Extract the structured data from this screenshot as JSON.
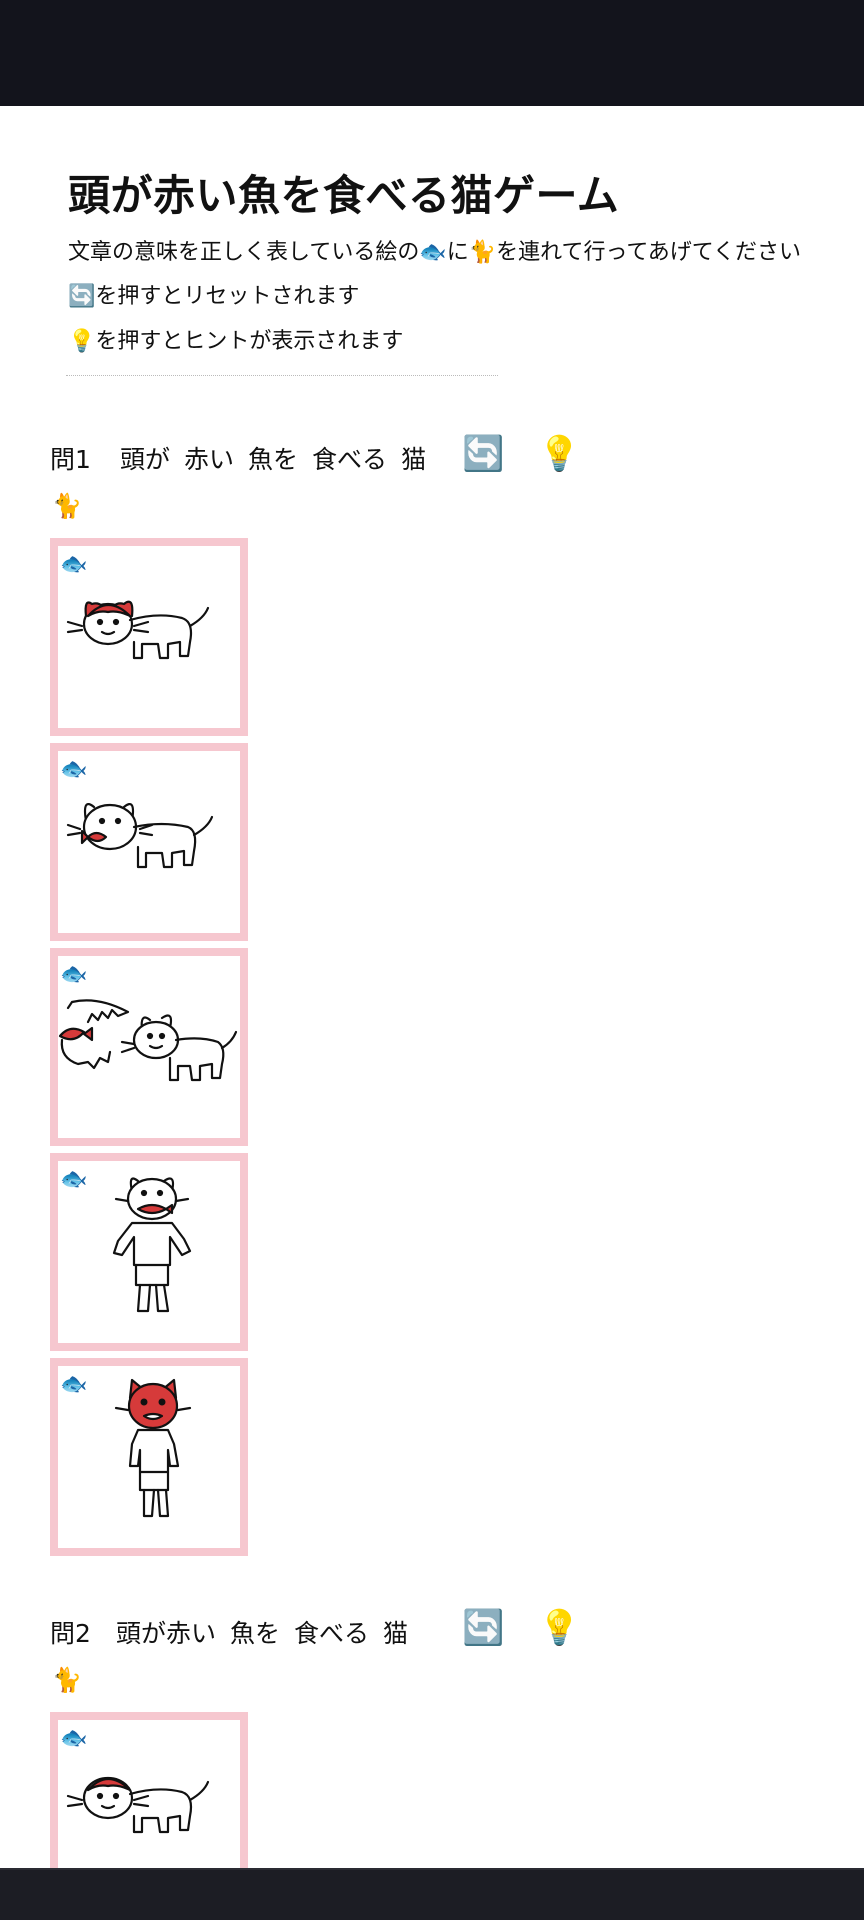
{
  "header": {
    "title": "頭が赤い魚を食べる猫ゲーム",
    "instructions": {
      "line1": "文章の意味を正しく表している絵の🐟に🐈を連れて行ってあげてください",
      "line2": "🔄を押すとリセットされます",
      "line3": "💡を押すとヒントが表示されます"
    }
  },
  "questions": [
    {
      "number": "問1",
      "words": [
        "頭が",
        "赤い",
        "魚を",
        "食べる",
        "猫"
      ],
      "reset_icon": "🔄",
      "hint_icon": "💡",
      "cat_icon": "🐈",
      "options": [
        {
          "fish_icon": "🐟",
          "picture": "cat-with-red-head-icon"
        },
        {
          "fish_icon": "🐟",
          "picture": "cat-eating-red-fish-icon"
        },
        {
          "fish_icon": "🐟",
          "picture": "shark-biting-red-fish-behind-cat-icon"
        },
        {
          "fish_icon": "🐟",
          "picture": "standing-cat-eating-red-fish-icon"
        },
        {
          "fish_icon": "🐟",
          "picture": "standing-cat-with-red-head-icon"
        }
      ]
    },
    {
      "number": "問2",
      "words": [
        "頭が赤い",
        "魚を",
        "食べる",
        "猫"
      ],
      "reset_icon": "🔄",
      "hint_icon": "💡",
      "cat_icon": "🐈",
      "options": [
        {
          "fish_icon": "🐟",
          "picture": "cat-with-red-head-icon"
        }
      ]
    }
  ],
  "colors": {
    "card_border": "#f6c7cf",
    "accent_red": "#d63a3a"
  }
}
